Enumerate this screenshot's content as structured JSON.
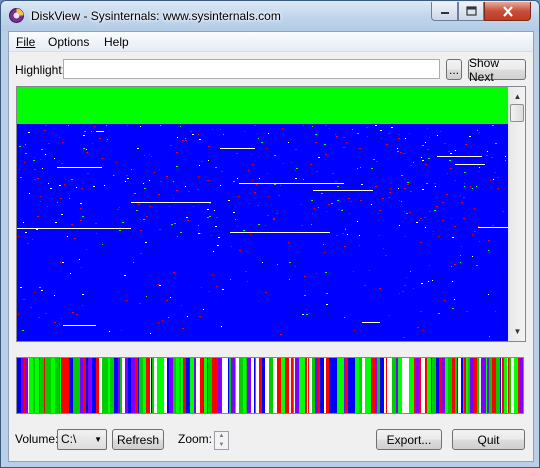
{
  "window": {
    "title": "DiskView - Sysinternals: www.sysinternals.com",
    "icon": "diskview-app-icon",
    "minimize_icon": "minimize-icon",
    "maximize_icon": "maximize-icon",
    "close_icon": "close-icon"
  },
  "menu": {
    "items": [
      {
        "label": "File",
        "mnemonic": "F"
      },
      {
        "label": "Options",
        "mnemonic": "O"
      },
      {
        "label": "Help",
        "mnemonic": "H"
      }
    ]
  },
  "highlight": {
    "label": "Highlight:",
    "value": "",
    "browse_label": "...",
    "show_next_label": "Show Next"
  },
  "disk_map": {
    "colors": {
      "used": "#0000ff",
      "header": "#00ff00",
      "fragment": "#ff0000",
      "free": "#ffffff"
    }
  },
  "cluster_bar": {
    "colors": [
      "#ff0000",
      "#00cc00",
      "#0000ff",
      "#7f00ff",
      "#00ff00",
      "#ffffff"
    ]
  },
  "footer": {
    "volume_label": "Volume:",
    "volume_value": "C:\\",
    "refresh_label": "Refresh",
    "zoom_label": "Zoom:",
    "export_label": "Export...",
    "quit_label": "Quit"
  }
}
